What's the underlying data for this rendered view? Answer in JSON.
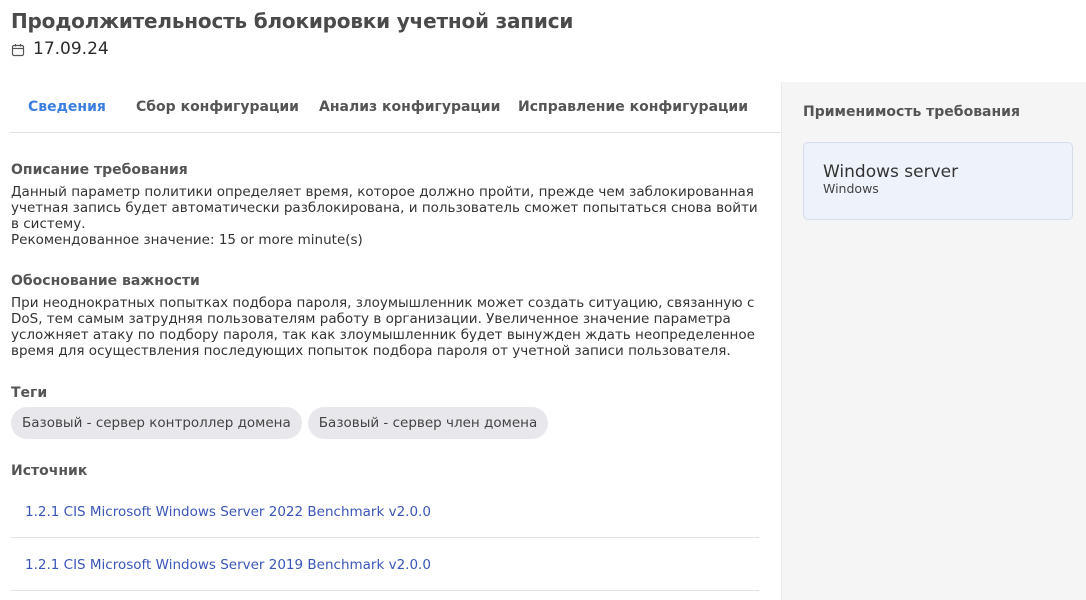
{
  "header": {
    "title": "Продолжительность блокировки учетной записи",
    "date": "17.09.24",
    "date_icon": "calendar-icon"
  },
  "tabs": [
    {
      "label": "Сведения",
      "active": true
    },
    {
      "label": "Сбор конфигурации",
      "active": false
    },
    {
      "label": "Анализ конфигурации",
      "active": false
    },
    {
      "label": "Исправление конфигурации",
      "active": false
    }
  ],
  "description": {
    "title": "Описание требования",
    "text": "Данный параметр политики определяет время, которое должно пройти, прежде чем заблокированная учетная запись будет автоматически разблокирована, и пользователь сможет попытаться снова войти в систему.",
    "recommended": "Рекомендованное значение: 15 or more minute(s)"
  },
  "justification": {
    "title": "Обоснование важности",
    "text": "При неоднократных попытках подбора пароля, злоумышленник может создать ситуацию, связанную с DoS, тем самым затрудняя пользователям работу в организации. Увеличенное значение параметра усложняет атаку по подбору пароля, так как злоумышленник будет вынужден ждать неопределенное время для осуществления последующих попыток подбора пароля от учетной записи пользователя."
  },
  "tags": {
    "title": "Теги",
    "items": [
      "Базовый - сервер контроллер домена",
      "Базовый - сервер член домена"
    ]
  },
  "source": {
    "title": "Источник",
    "items": [
      "1.2.1 CIS Microsoft Windows Server 2022 Benchmark v2.0.0",
      "1.2.1 CIS Microsoft Windows Server 2019 Benchmark v2.0.0"
    ]
  },
  "sidebar": {
    "title": "Применимость требования",
    "os": {
      "name": "Windows server",
      "family": "Windows"
    }
  },
  "colors": {
    "accent": "#3b7ee0",
    "link": "#3a56b8",
    "sidebar_bg": "#f5f5f5",
    "card_bg": "#eef2fb"
  }
}
